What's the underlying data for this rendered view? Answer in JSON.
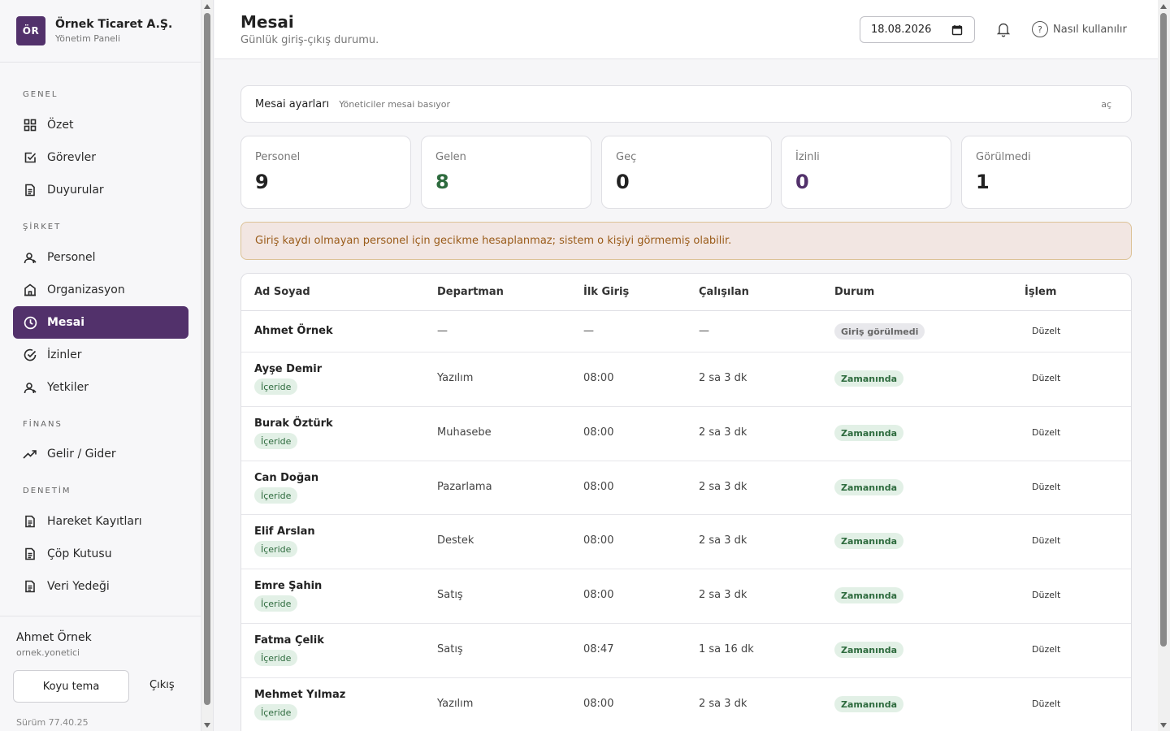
{
  "brand": {
    "logo": "ÖR",
    "name": "Örnek Ticaret A.Ş.",
    "subtitle": "Yönetim Paneli"
  },
  "nav": {
    "sections": [
      {
        "label": "GENEL"
      },
      {
        "label": "ŞİRKET"
      },
      {
        "label": "FİNANS"
      },
      {
        "label": "DENETİM"
      }
    ],
    "items": [
      {
        "label": "Özet",
        "icon": "grid-icon"
      },
      {
        "label": "Görevler",
        "icon": "checkbox-icon"
      },
      {
        "label": "Duyurular",
        "icon": "document-icon"
      },
      {
        "label": "Personel",
        "icon": "user-icon"
      },
      {
        "label": "Organizasyon",
        "icon": "building-icon"
      },
      {
        "label": "Mesai",
        "icon": "clock-icon",
        "active": true
      },
      {
        "label": "İzinler",
        "icon": "check-circle-icon"
      },
      {
        "label": "Yetkiler",
        "icon": "user-icon"
      },
      {
        "label": "Gelir / Gider",
        "icon": "trend-icon"
      },
      {
        "label": "Hareket Kayıtları",
        "icon": "document-icon"
      },
      {
        "label": "Çöp Kutusu",
        "icon": "document-icon"
      },
      {
        "label": "Veri Yedeği",
        "icon": "document-icon"
      }
    ]
  },
  "footer": {
    "user_name": "Ahmet Örnek",
    "user_login": "ornek.yonetici",
    "theme_button": "Koyu tema",
    "logout": "Çıkış",
    "version": "Sürüm 77.40.25"
  },
  "header": {
    "title": "Mesai",
    "subtitle": "Günlük giriş-çıkış durumu.",
    "date": "18.08.2026",
    "help": "Nasıl kullanılır"
  },
  "settings": {
    "title": "Mesai ayarları",
    "note": "Yöneticiler mesai basıyor",
    "toggle": "aç"
  },
  "stats": [
    {
      "label": "Personel",
      "value": "9",
      "color": "#222222"
    },
    {
      "label": "Gelen",
      "value": "8",
      "color": "#2e6b3e"
    },
    {
      "label": "Geç",
      "value": "0",
      "color": "#222222"
    },
    {
      "label": "İzinli",
      "value": "0",
      "color": "#52316b"
    },
    {
      "label": "Görülmedi",
      "value": "1",
      "color": "#222222"
    }
  ],
  "warning": "Giriş kaydı olmayan personel için gecikme hesaplanmaz; sistem o kişiyi görmemiş olabilir.",
  "table": {
    "headers": [
      "Ad Soyad",
      "Departman",
      "İlk Giriş",
      "Çalışılan",
      "Durum",
      "İşlem"
    ],
    "rows": [
      {
        "name": "Ahmet Örnek",
        "badge": "",
        "dept": "—",
        "first_in": "—",
        "worked": "—",
        "status": "Giriş görülmedi",
        "action": "Düzelt"
      },
      {
        "name": "Ayşe Demir",
        "badge": "İçeride",
        "dept": "Yazılım",
        "first_in": "08:00",
        "worked": "2 sa 3 dk",
        "status": "Zamanında",
        "action": "Düzelt"
      },
      {
        "name": "Burak Öztürk",
        "badge": "İçeride",
        "dept": "Muhasebe",
        "first_in": "08:00",
        "worked": "2 sa 3 dk",
        "status": "Zamanında",
        "action": "Düzelt"
      },
      {
        "name": "Can Doğan",
        "badge": "İçeride",
        "dept": "Pazarlama",
        "first_in": "08:00",
        "worked": "2 sa 3 dk",
        "status": "Zamanında",
        "action": "Düzelt"
      },
      {
        "name": "Elif Arslan",
        "badge": "İçeride",
        "dept": "Destek",
        "first_in": "08:00",
        "worked": "2 sa 3 dk",
        "status": "Zamanında",
        "action": "Düzelt"
      },
      {
        "name": "Emre Şahin",
        "badge": "İçeride",
        "dept": "Satış",
        "first_in": "08:00",
        "worked": "2 sa 3 dk",
        "status": "Zamanında",
        "action": "Düzelt"
      },
      {
        "name": "Fatma Çelik",
        "badge": "İçeride",
        "dept": "Satış",
        "first_in": "08:47",
        "worked": "1 sa 16 dk",
        "status": "Zamanında",
        "action": "Düzelt"
      },
      {
        "name": "Mehmet Yılmaz",
        "badge": "İçeride",
        "dept": "Yazılım",
        "first_in": "08:00",
        "worked": "2 sa 3 dk",
        "status": "Zamanında",
        "action": "Düzelt"
      }
    ]
  }
}
